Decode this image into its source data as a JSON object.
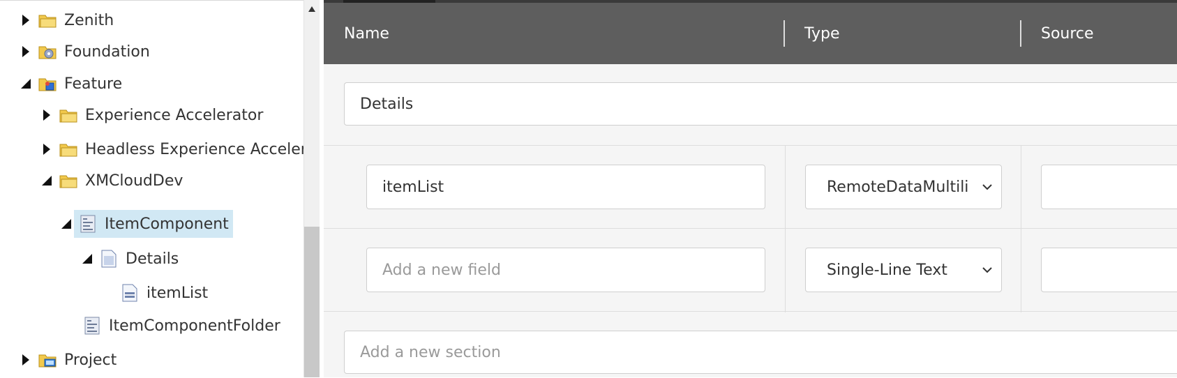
{
  "tree": {
    "items": [
      {
        "label": "Zenith",
        "expanded": false,
        "icon": "folder-icon"
      },
      {
        "label": "Foundation",
        "expanded": false,
        "icon": "folder-gear-icon"
      },
      {
        "label": "Feature",
        "expanded": true,
        "icon": "folder-feature-icon"
      },
      {
        "label": "Experience Accelerator",
        "expanded": false,
        "icon": "folder-icon"
      },
      {
        "label": "Headless Experience Accelera",
        "expanded": false,
        "icon": "folder-icon"
      },
      {
        "label": "XMCloudDev",
        "expanded": true,
        "icon": "folder-icon"
      },
      {
        "label": "ItemComponent",
        "expanded": true,
        "selected": true,
        "icon": "template-icon"
      },
      {
        "label": "Details",
        "expanded": true,
        "icon": "section-icon"
      },
      {
        "label": "itemList",
        "icon": "field-icon"
      },
      {
        "label": "ItemComponentFolder",
        "icon": "template-icon"
      },
      {
        "label": "Project",
        "expanded": false,
        "icon": "folder-project-icon"
      }
    ]
  },
  "editor": {
    "columns": {
      "name": "Name",
      "type": "Type",
      "source": "Source"
    },
    "section": {
      "name": "Details"
    },
    "fields": [
      {
        "name": "itemList",
        "type": "RemoteDataMultili",
        "source": ""
      },
      {
        "name_placeholder": "Add a new field",
        "type": "Single-Line Text",
        "source": ""
      }
    ],
    "new_section_placeholder": "Add a new section"
  }
}
